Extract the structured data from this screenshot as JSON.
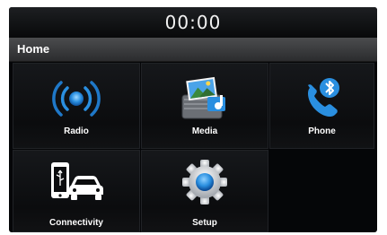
{
  "status_bar": {
    "time": "00:00"
  },
  "header": {
    "title": "Home"
  },
  "menu": {
    "radio": {
      "label": "Radio",
      "icon": "radio-broadcast-icon"
    },
    "media": {
      "label": "Media",
      "icon": "media-gallery-icon"
    },
    "phone": {
      "label": "Phone",
      "icon": "bluetooth-phone-icon"
    },
    "connectivity": {
      "label": "Connectivity",
      "icon": "phone-car-connectivity-icon"
    },
    "setup": {
      "label": "Setup",
      "icon": "gear-icon"
    }
  },
  "colors": {
    "accent_blue": "#2a8fe0",
    "background": "#050608"
  }
}
